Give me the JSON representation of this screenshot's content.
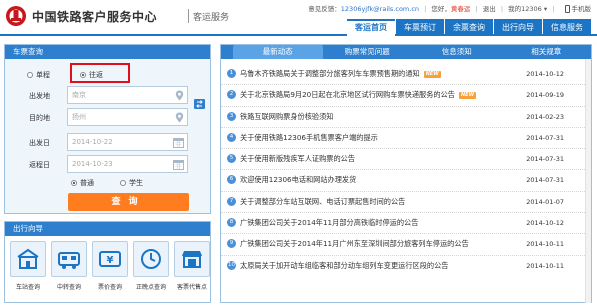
{
  "header": {
    "brand": "中国铁路客户服务中心",
    "sub": "客运服务",
    "topbar": {
      "feedback_label": "意见反馈：",
      "feedback_email": "12306yjfk@rails.com.cn",
      "greeting": "您好，",
      "user": "黄春运",
      "logout": "退出",
      "my": "我的12306",
      "mobile": "手机版"
    },
    "nav": [
      "客运首页",
      "车票预订",
      "余票查询",
      "出行向导",
      "信息服务"
    ]
  },
  "ticket_panel": {
    "title": "车票查询",
    "trip_types": [
      "单程",
      "往返"
    ],
    "selected_trip": "往返",
    "from_label": "出发地",
    "from_value": "南京",
    "to_label": "目的地",
    "to_value": "扬州",
    "depart_label": "出发日",
    "depart_value": "2014-10-22",
    "return_label": "返程日",
    "return_value": "2014-10-23",
    "passenger_types": [
      "普通",
      "学生"
    ],
    "selected_passenger": "普通",
    "search_label": "查询"
  },
  "guide": {
    "title": "出行向导",
    "items": [
      {
        "label": "车站查询",
        "icon": "station-icon"
      },
      {
        "label": "中转查询",
        "icon": "transfer-icon"
      },
      {
        "label": "票价查询",
        "icon": "fare-icon"
      },
      {
        "label": "正晚点查询",
        "icon": "clock-icon"
      },
      {
        "label": "客票代售点",
        "icon": "agency-icon"
      }
    ]
  },
  "news": {
    "tabs": [
      "最新动态",
      "购票常见问题",
      "信息须知",
      "相关规章"
    ],
    "items": [
      {
        "num": "1",
        "title": "乌鲁木齐铁路局关于调整部分旅客列车车票预售期的通知",
        "new": "NEW",
        "date": "2014-10-12"
      },
      {
        "num": "2",
        "title": "关于北京铁路局9月20日起在北京地区试行网购车票快递服务的公告",
        "new": "NEW",
        "date": "2014-09-19"
      },
      {
        "num": "3",
        "title": "铁路互联网购票身份核验须知",
        "new": "",
        "date": "2014-02-23"
      },
      {
        "num": "4",
        "title": "关于使用铁路12306手机售票客户端的提示",
        "new": "",
        "date": "2014-07-31"
      },
      {
        "num": "5",
        "title": "关于使用新版残疾军人证购票的公告",
        "new": "",
        "date": "2014-07-31"
      },
      {
        "num": "6",
        "title": "欢迎使用12306电话和网站办理发货",
        "new": "",
        "date": "2014-07-31"
      },
      {
        "num": "7",
        "title": "关于调整部分车站互联网、电话订票起售时间的公告",
        "new": "",
        "date": "2014-01-07"
      },
      {
        "num": "8",
        "title": "广铁集团公司关于2014年11月部分高铁临时停运的公告",
        "new": "",
        "date": "2014-10-12"
      },
      {
        "num": "9",
        "title": "广铁集团公司关于2014年11月广州东至深圳间部分旅客列车停运的公告",
        "new": "",
        "date": "2014-10-11"
      },
      {
        "num": "10",
        "title": "太原局关于加开动车组临客和部分动车组列车变更运行区段的公告",
        "new": "",
        "date": "2014-10-11"
      }
    ]
  },
  "colors": {
    "primary": "#1b75c4",
    "accent": "#ff7d1f",
    "highlight": "#e0101a"
  }
}
